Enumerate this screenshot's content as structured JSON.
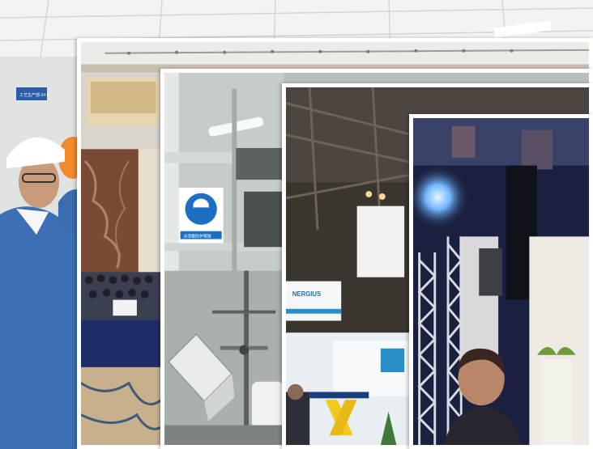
{
  "collage": {
    "photos": [
      {
        "subject": "workers-in-hard-hats",
        "sign_text": "工艺生产部-2#-1"
      },
      {
        "subject": "conference-hall"
      },
      {
        "subject": "lab-equipment-with-safety-sign",
        "sign_text": "必须戴防护眼镜"
      },
      {
        "subject": "exhibition-hall",
        "banner_text": "NERGIUS"
      },
      {
        "subject": "stage-with-truss-and-speaker"
      }
    ],
    "colors": {
      "frame": "#ffffff",
      "workwear_blue": "#3c6fb4",
      "carpet_navy": "#1f2e66",
      "safety_blue": "#1c6fc4",
      "night_blue": "#1a2140"
    }
  }
}
